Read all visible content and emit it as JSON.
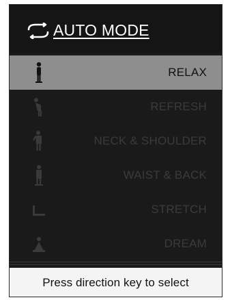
{
  "header": {
    "title": "AUTO MODE",
    "icon": "cycle-arrows-icon"
  },
  "menu": {
    "items": [
      {
        "label": "RELAX",
        "icon": "standing-person-icon",
        "selected": true
      },
      {
        "label": "REFRESH",
        "icon": "bending-person-icon",
        "selected": false
      },
      {
        "label": "NECK & SHOULDER",
        "icon": "neck-shoulder-person-icon",
        "selected": false
      },
      {
        "label": "WAIST & BACK",
        "icon": "waist-back-person-icon",
        "selected": false
      },
      {
        "label": "STRETCH",
        "icon": "stretch-legs-icon",
        "selected": false
      },
      {
        "label": "DREAM",
        "icon": "lotus-meditation-icon",
        "selected": false
      }
    ]
  },
  "footer": {
    "hint": "Press direction key to select"
  },
  "colors": {
    "background": "#1a1a1a",
    "selected_row": "#8e8e8e",
    "dim_text": "#3b3b3b",
    "header_text": "#ffffff",
    "footer_bg": "#f4f4f4"
  }
}
